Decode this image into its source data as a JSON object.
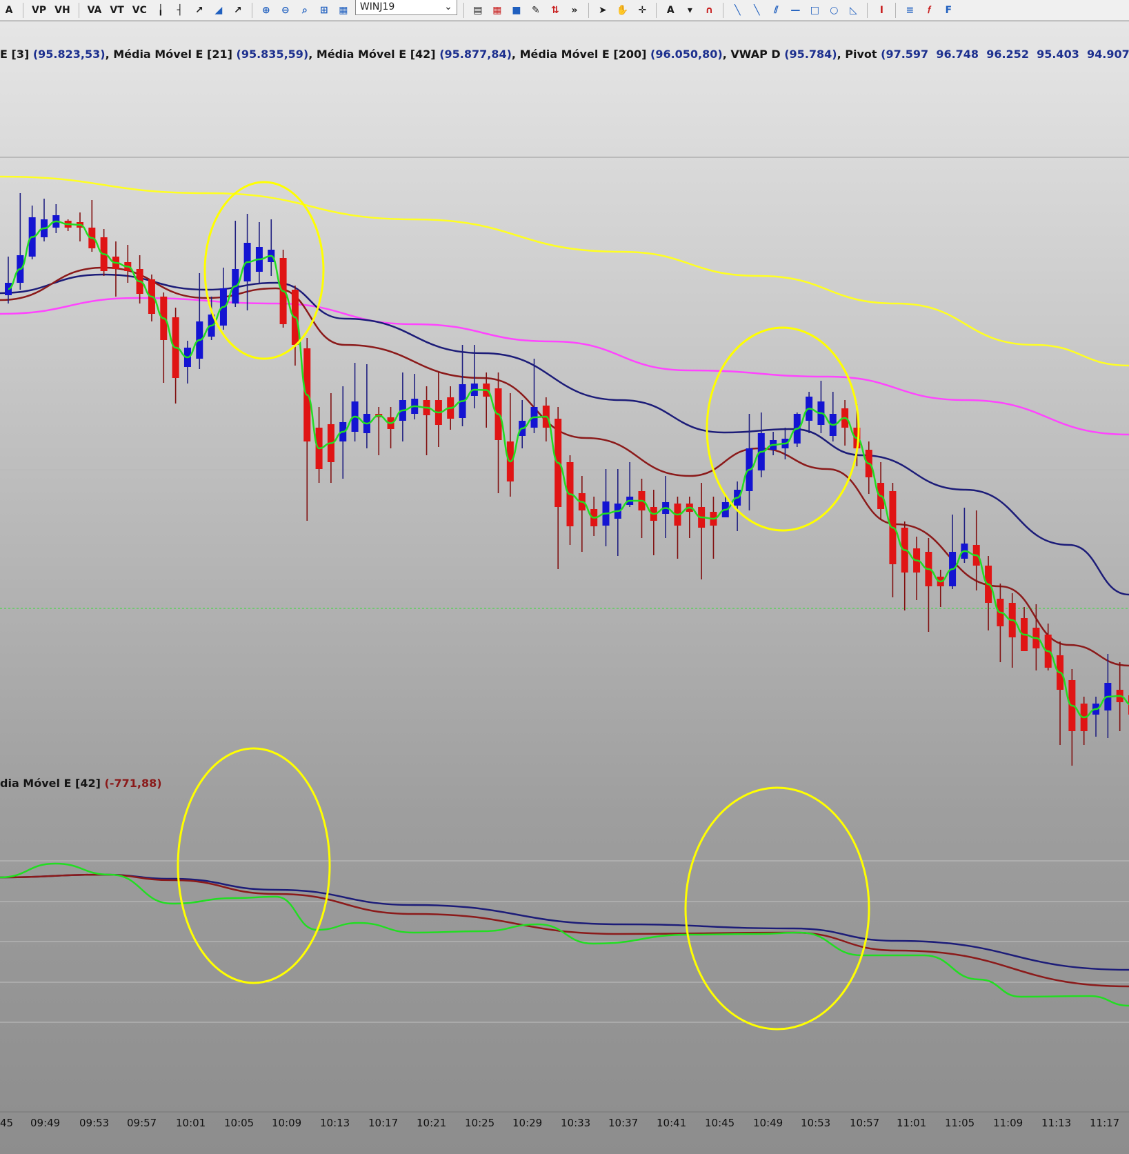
{
  "toolbar": {
    "tools": [
      "A",
      "VP",
      "VH",
      "VA",
      "VT",
      "VC",
      "candle-icon",
      "line-icon",
      "trend-icon",
      "ema-icon",
      "zoom-in-icon",
      "zoom-out-icon",
      "magnify-icon",
      "grid-icon"
    ],
    "symbol": "WINJ19",
    "right_tools": [
      "arrow-cursor-icon",
      "hand-icon",
      "crosshair-icon",
      "text-icon",
      "magnet-icon",
      "line-tool-icon",
      "channel-icon",
      "rectangle-icon",
      "ellipse-icon",
      "fibonacci-icon"
    ]
  },
  "legend_main": {
    "items": [
      {
        "label": "E [3]",
        "value": "(95.823,53)"
      },
      {
        "label": "Média Móvel E [21]",
        "value": "(95.835,59)"
      },
      {
        "label": "Média Móvel E [42]",
        "value": "(95.877,84)"
      },
      {
        "label": "Média Móvel E [200]",
        "value": "(96.050,80)"
      },
      {
        "label": "VWAP D",
        "value": "(95.784)"
      },
      {
        "label": "Pivot",
        "value": "(97.597  96.748  96.252  95.403  94.907)"
      }
    ]
  },
  "legend_osc": {
    "label": "dia Móvel E [42]",
    "value": "(-771,88)"
  },
  "chart_data": {
    "type": "candlestick",
    "x_ticks": [
      "45",
      "09:49",
      "09:53",
      "09:57",
      "10:01",
      "10:05",
      "10:09",
      "10:13",
      "10:17",
      "10:21",
      "10:25",
      "10:29",
      "10:33",
      "10:37",
      "10:41",
      "10:45",
      "10:49",
      "10:53",
      "10:57",
      "11:01",
      "11:05",
      "11:09",
      "11:13",
      "11:17"
    ],
    "candle_colors": {
      "up": "#1414d2",
      "down": "#e01414",
      "wick_up": "#202080",
      "wick_down": "#801010"
    },
    "line_colors": {
      "ema3": "#22dd22",
      "ema21": "#8b1a1a",
      "ema42": "#1c1c78",
      "ema200": "#ff44ff",
      "vwap": "#ffff22",
      "highlight": "#ffff00"
    },
    "candles": [
      [
        "u",
        410,
        428,
        372,
        440
      ],
      [
        "u",
        370,
        410,
        280,
        420
      ],
      [
        "u",
        315,
        372,
        298,
        376
      ],
      [
        "u",
        318,
        344,
        288,
        350
      ],
      [
        "u",
        312,
        330,
        296,
        338
      ],
      [
        "d",
        320,
        330,
        318,
        335
      ],
      [
        "d",
        322,
        330,
        308,
        350
      ],
      [
        "d",
        330,
        360,
        290,
        365
      ],
      [
        "d",
        344,
        393,
        332,
        400
      ],
      [
        "d",
        372,
        390,
        350,
        430
      ],
      [
        "d",
        380,
        393,
        355,
        410
      ],
      [
        "d",
        390,
        426,
        370,
        440
      ],
      [
        "d",
        405,
        455,
        398,
        466
      ],
      [
        "d",
        430,
        493,
        424,
        555
      ],
      [
        "d",
        460,
        548,
        446,
        585
      ],
      [
        "u",
        504,
        532,
        494,
        556
      ],
      [
        "u",
        466,
        520,
        396,
        535
      ],
      [
        "u",
        456,
        488,
        430,
        493
      ],
      [
        "u",
        418,
        472,
        388,
        478
      ],
      [
        "u",
        390,
        440,
        320,
        445
      ],
      [
        "u",
        352,
        408,
        310,
        450
      ],
      [
        "u",
        358,
        394,
        322,
        410
      ],
      [
        "u",
        362,
        380,
        318,
        400
      ],
      [
        "d",
        374,
        470,
        362,
        475
      ],
      [
        "d",
        420,
        500,
        414,
        530
      ],
      [
        "d",
        505,
        640,
        490,
        755
      ],
      [
        "d",
        620,
        680,
        590,
        700
      ],
      [
        "d",
        615,
        670,
        570,
        700
      ],
      [
        "u",
        612,
        640,
        560,
        694
      ],
      [
        "u",
        582,
        626,
        526,
        640
      ],
      [
        "u",
        600,
        628,
        528,
        650
      ],
      [
        "d",
        600,
        605,
        590,
        660
      ],
      [
        "d",
        605,
        622,
        590,
        650
      ],
      [
        "u",
        580,
        610,
        540,
        640
      ],
      [
        "u",
        578,
        600,
        542,
        608
      ],
      [
        "d",
        580,
        602,
        560,
        660
      ],
      [
        "d",
        580,
        616,
        540,
        648
      ],
      [
        "d",
        576,
        607,
        560,
        623
      ],
      [
        "u",
        557,
        606,
        500,
        618
      ],
      [
        "u",
        556,
        574,
        500,
        592
      ],
      [
        "d",
        556,
        575,
        540,
        620
      ],
      [
        "d",
        563,
        638,
        540,
        715
      ],
      [
        "d",
        640,
        698,
        570,
        720
      ],
      [
        "u",
        610,
        632,
        580,
        650
      ],
      [
        "u",
        590,
        620,
        520,
        628
      ],
      [
        "d",
        588,
        620,
        576,
        640
      ],
      [
        "d",
        607,
        735,
        590,
        825
      ],
      [
        "d",
        670,
        763,
        660,
        790
      ],
      [
        "d",
        715,
        740,
        690,
        800
      ],
      [
        "d",
        738,
        763,
        720,
        777
      ],
      [
        "u",
        727,
        762,
        680,
        792
      ],
      [
        "u",
        730,
        752,
        680,
        806
      ],
      [
        "u",
        720,
        732,
        670,
        735
      ],
      [
        "d",
        712,
        740,
        694,
        780
      ],
      [
        "d",
        735,
        755,
        710,
        805
      ],
      [
        "u",
        728,
        745,
        690,
        780
      ],
      [
        "d",
        730,
        762,
        720,
        810
      ],
      [
        "d",
        730,
        742,
        720,
        780
      ],
      [
        "d",
        735,
        765,
        700,
        840
      ],
      [
        "d",
        742,
        762,
        720,
        810
      ],
      [
        "u",
        728,
        750,
        720,
        750
      ],
      [
        "u",
        710,
        733,
        698,
        770
      ],
      [
        "u",
        650,
        712,
        600,
        740
      ],
      [
        "u",
        628,
        682,
        598,
        692
      ],
      [
        "u",
        638,
        652,
        626,
        660
      ],
      [
        "u",
        636,
        650,
        620,
        666
      ],
      [
        "u",
        600,
        643,
        598,
        648
      ],
      [
        "u",
        575,
        610,
        568,
        628
      ],
      [
        "u",
        582,
        616,
        552,
        628
      ],
      [
        "u",
        600,
        632,
        568,
        640
      ],
      [
        "d",
        592,
        620,
        580,
        646
      ],
      [
        "d",
        620,
        650,
        586,
        676
      ],
      [
        "d",
        652,
        692,
        640,
        716
      ],
      [
        "d",
        700,
        738,
        670,
        754
      ],
      [
        "d",
        712,
        818,
        700,
        866
      ],
      [
        "d",
        765,
        830,
        756,
        885
      ],
      [
        "d",
        795,
        830,
        778,
        870
      ],
      [
        "d",
        800,
        850,
        780,
        916
      ],
      [
        "d",
        836,
        850,
        826,
        880
      ],
      [
        "u",
        800,
        850,
        746,
        854
      ],
      [
        "u",
        788,
        810,
        736,
        816
      ],
      [
        "d",
        790,
        820,
        740,
        856
      ],
      [
        "d",
        820,
        874,
        806,
        914
      ],
      [
        "d",
        868,
        908,
        846,
        960
      ],
      [
        "d",
        874,
        924,
        860,
        968
      ],
      [
        "d",
        896,
        944,
        880,
        930
      ],
      [
        "d",
        910,
        940,
        876,
        972
      ],
      [
        "d",
        920,
        968,
        904,
        972
      ],
      [
        "d",
        950,
        1000,
        930,
        1080
      ],
      [
        "d",
        986,
        1060,
        970,
        1110
      ],
      [
        "d",
        1020,
        1060,
        1010,
        1080
      ],
      [
        "u",
        1020,
        1036,
        1010,
        1068
      ],
      [
        "u",
        990,
        1030,
        948,
        1070
      ],
      [
        "d",
        1000,
        1018,
        960,
        1060
      ],
      [
        "d",
        1008,
        1036,
        1000,
        1060
      ],
      [
        "d",
        1020,
        1070,
        1010,
        1070
      ],
      [
        "d",
        1075,
        1122,
        1065,
        1122
      ],
      [
        "d",
        1075,
        1110,
        1065,
        1122
      ]
    ],
    "highlight_ellipses": 4
  }
}
